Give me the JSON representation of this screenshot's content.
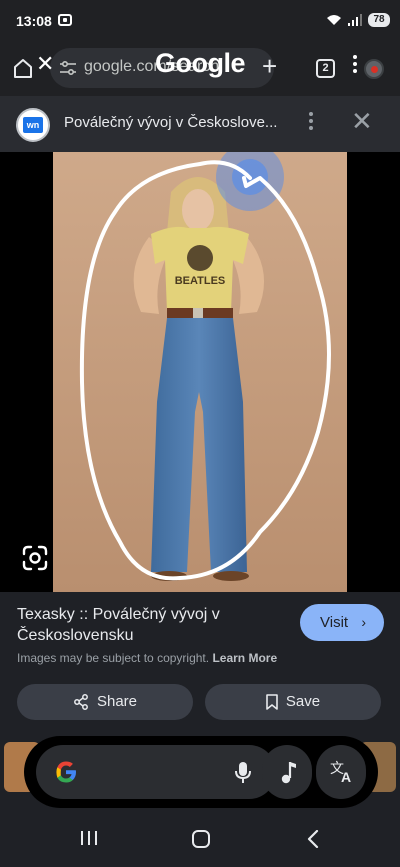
{
  "status_bar": {
    "time": "13:08",
    "battery": "78"
  },
  "toolbar": {
    "url": "google.com/search",
    "wordmark": "Google",
    "tab_count": "2"
  },
  "source": {
    "favicon_text": "wn",
    "title": "Poválečný vývoj v Českoslove..."
  },
  "result": {
    "title": "Texasky :: Poválečný vývoj v Československu",
    "visit_label": "Visit",
    "copyright_notice": "Images may be subject to copyright.",
    "learn_more_label": "Learn More",
    "share_label": "Share",
    "save_label": "Save"
  },
  "photo": {
    "shirt_text": "BEATLES"
  },
  "colors": {
    "accent": "#8ab4f8",
    "background": "#1f2126",
    "toolbar": "#202124",
    "source_bar": "#2a2c31",
    "button": "#3a3e47",
    "drawn_circle": "#ffffff",
    "touch_highlight": "#4a8af4"
  },
  "icons": {
    "home": "home-icon",
    "close": "close-icon",
    "tune": "tune-icon",
    "new_tab": "plus-icon",
    "menu": "more-vert-icon",
    "lens": "google-lens-icon",
    "share": "share-icon",
    "save": "bookmark-icon",
    "mic": "microphone-icon",
    "music": "music-note-icon",
    "translate": "translate-icon"
  }
}
